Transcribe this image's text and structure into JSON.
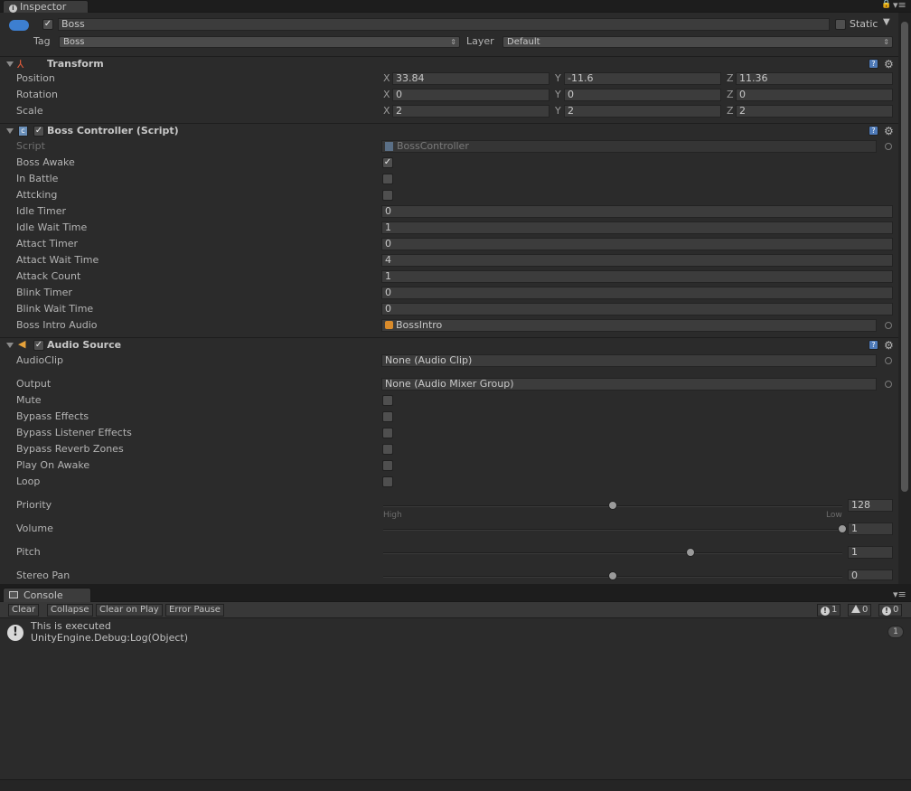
{
  "inspector": {
    "tab_label": "Inspector",
    "object": {
      "active": true,
      "name": "Boss",
      "static_label": "Static",
      "static": false,
      "tag_label": "Tag",
      "tag_value": "Boss",
      "layer_label": "Layer",
      "layer_value": "Default"
    },
    "transform": {
      "title": "Transform",
      "rows": [
        {
          "label": "Position",
          "x": "33.84",
          "y": "-11.6",
          "z": "11.36"
        },
        {
          "label": "Rotation",
          "x": "0",
          "y": "0",
          "z": "0"
        },
        {
          "label": "Scale",
          "x": "2",
          "y": "2",
          "z": "2"
        }
      ],
      "axis_x": "X",
      "axis_y": "Y",
      "axis_z": "Z"
    },
    "boss_controller": {
      "title": "Boss Controller (Script)",
      "script_label": "Script",
      "script_value": "BossController",
      "boss_awake_label": "Boss Awake",
      "boss_awake": true,
      "in_battle_label": "In Battle",
      "in_battle": false,
      "attcking_label": "Attcking",
      "attcking": false,
      "idle_timer_label": "Idle Timer",
      "idle_timer": "0",
      "idle_wait_time_label": "Idle Wait Time",
      "idle_wait_time": "1",
      "attact_timer_label": "Attact Timer",
      "attact_timer": "0",
      "attact_wait_time_label": "Attact Wait Time",
      "attact_wait_time": "4",
      "attack_count_label": "Attack Count",
      "attack_count": "1",
      "blink_timer_label": "Blink Timer",
      "blink_timer": "0",
      "blink_wait_time_label": "Blink Wait Time",
      "blink_wait_time": "0",
      "boss_intro_audio_label": "Boss Intro Audio",
      "boss_intro_audio": "BossIntro"
    },
    "audio_source": {
      "title": "Audio Source",
      "audioclip_label": "AudioClip",
      "audioclip": "None (Audio Clip)",
      "output_label": "Output",
      "output": "None (Audio Mixer Group)",
      "mute_label": "Mute",
      "bypass_effects_label": "Bypass Effects",
      "bypass_listener_label": "Bypass Listener Effects",
      "bypass_reverb_label": "Bypass Reverb Zones",
      "play_on_awake_label": "Play On Awake",
      "loop_label": "Loop",
      "priority_label": "Priority",
      "priority": "128",
      "priority_fraction": 0.5,
      "priority_high": "High",
      "priority_low": "Low",
      "volume_label": "Volume",
      "volume": "1",
      "volume_fraction": 1.0,
      "pitch_label": "Pitch",
      "pitch": "1",
      "pitch_fraction": 0.67,
      "stereo_pan_label": "Stereo Pan",
      "stereo_pan": "0",
      "stereo_pan_fraction": 0.5
    }
  },
  "console": {
    "tab_label": "Console",
    "buttons": {
      "clear": "Clear",
      "collapse": "Collapse",
      "clear_on_play": "Clear on Play",
      "error_pause": "Error Pause"
    },
    "counts": {
      "info": "1",
      "warning": "0",
      "error": "0"
    },
    "entry": {
      "line1": "This is executed",
      "line2": "UnityEngine.Debug:Log(Object)",
      "count": "1"
    }
  },
  "colors": {
    "panel": "#2b2b2b",
    "field": "#3c3c3c",
    "accent": "#4e7ab8"
  }
}
